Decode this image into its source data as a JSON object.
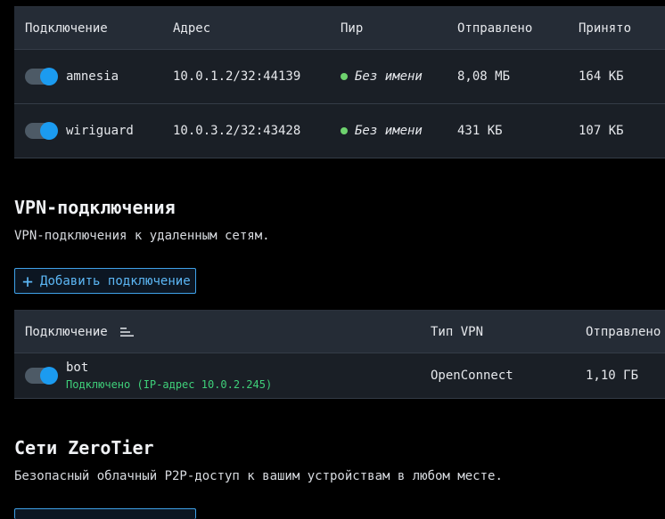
{
  "tunnels_table": {
    "headers": {
      "connection": "Подключение",
      "address": "Адрес",
      "peer": "Пир",
      "sent": "Отправлено",
      "received": "Принято"
    },
    "rows": [
      {
        "name": "amnesia",
        "address": "10.0.1.2/32:44139",
        "peer": "Без имени",
        "sent": "8,08 МБ",
        "received": "164 КБ",
        "enabled": true
      },
      {
        "name": "wiriguard",
        "address": "10.0.3.2/32:43428",
        "peer": "Без имени",
        "sent": "431 КБ",
        "received": "107 КБ",
        "enabled": true
      }
    ]
  },
  "vpn_section": {
    "title": "VPN-подключения",
    "description": "VPN-подключения к удаленным сетям.",
    "add_button": "Добавить подключение",
    "headers": {
      "connection": "Подключение",
      "vpn_type": "Тип VPN",
      "sent": "Отправлено"
    },
    "rows": [
      {
        "name": "bot",
        "status": "Подключено (IP-адрес 10.0.2.245)",
        "vpn_type": "OpenConnect",
        "sent": "1,10 ГБ",
        "enabled": true
      }
    ]
  },
  "zerotier_section": {
    "title": "Сети ZeroTier",
    "description": "Безопасный облачный P2P-доступ к вашим устройствам в любом месте."
  },
  "colors": {
    "accent": "#1b9bf0",
    "peer_online": "#6ed26e",
    "status_ok": "#3fd07a"
  }
}
